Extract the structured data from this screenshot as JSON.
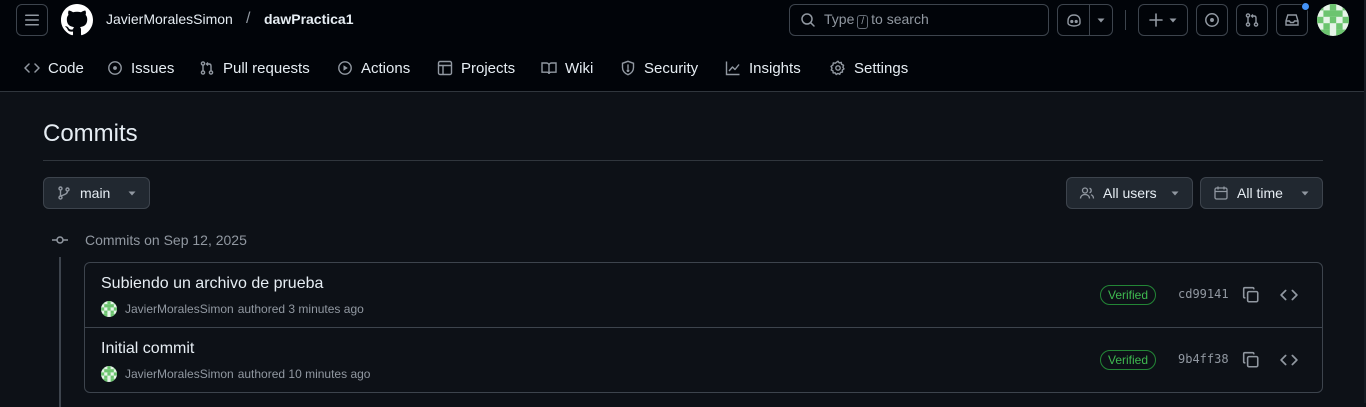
{
  "header": {
    "owner": "JavierMoralesSimon",
    "separator": "/",
    "repo": "dawPractica1",
    "search_prefix": "Type",
    "search_key": "/",
    "search_suffix": "to search"
  },
  "nav": {
    "items": [
      {
        "label": "Code",
        "icon": "code-icon"
      },
      {
        "label": "Issues",
        "icon": "issue-icon"
      },
      {
        "label": "Pull requests",
        "icon": "pull-request-icon"
      },
      {
        "label": "Actions",
        "icon": "play-icon"
      },
      {
        "label": "Projects",
        "icon": "table-icon"
      },
      {
        "label": "Wiki",
        "icon": "book-icon"
      },
      {
        "label": "Security",
        "icon": "shield-icon"
      },
      {
        "label": "Insights",
        "icon": "graph-icon"
      },
      {
        "label": "Settings",
        "icon": "gear-icon"
      }
    ]
  },
  "page": {
    "title": "Commits",
    "branch": "main",
    "users_filter": "All users",
    "time_filter": "All time",
    "date_heading": "Commits on Sep 12, 2025"
  },
  "commits": [
    {
      "message": "Subiendo un archivo de prueba",
      "author": "JavierMoralesSimon",
      "meta": "authored 3 minutes ago",
      "badge": "Verified",
      "sha": "cd99141"
    },
    {
      "message": "Initial commit",
      "author": "JavierMoralesSimon",
      "meta": "authored 10 minutes ago",
      "badge": "Verified",
      "sha": "9b4ff38"
    }
  ],
  "colors": {
    "background": "#0d1117",
    "header_bg": "#010409",
    "verified": "#3fb950",
    "notification": "#4493f8"
  }
}
